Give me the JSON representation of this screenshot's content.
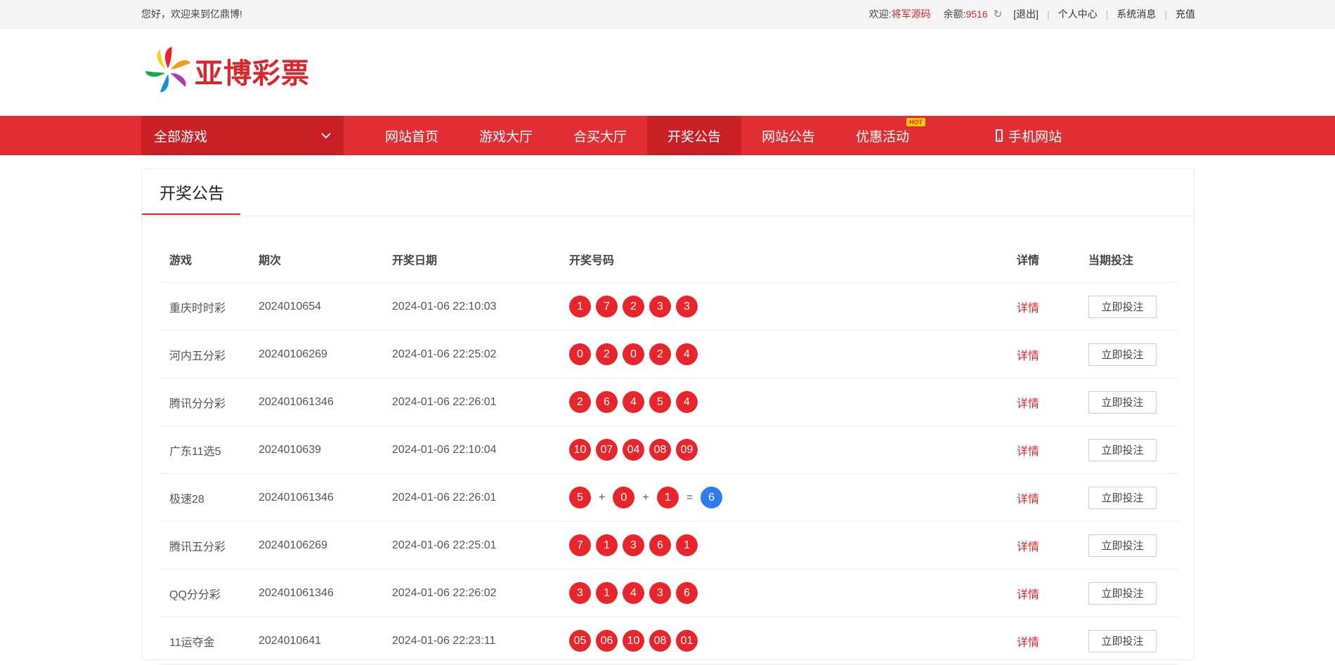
{
  "topbar": {
    "greeting": "您好，欢迎来到亿鼎博!",
    "welcome_label": "欢迎:",
    "username": "将军源码",
    "balance_label": "余额:",
    "balance": "9516",
    "logout": "[退出]",
    "personal_center": "个人中心",
    "messages": "系统消息",
    "recharge": "充值"
  },
  "logo": {
    "text": "亚博彩票"
  },
  "nav": {
    "all_games": "全部游戏",
    "items": [
      {
        "label": "网站首页",
        "active": false
      },
      {
        "label": "游戏大厅",
        "active": false
      },
      {
        "label": "合买大厅",
        "active": false
      },
      {
        "label": "开奖公告",
        "active": true
      },
      {
        "label": "网站公告",
        "active": false
      },
      {
        "label": "优惠活动",
        "active": false,
        "badge": "HOT"
      }
    ],
    "mobile": "手机网站"
  },
  "panel": {
    "title": "开奖公告"
  },
  "table": {
    "headers": [
      "游戏",
      "期次",
      "开奖日期",
      "开奖号码",
      "详情",
      "当期投注"
    ],
    "rows": [
      {
        "game": "重庆时时彩",
        "issue": "2024010654",
        "date": "2024-01-06 22:10:03",
        "numbers": [
          "1",
          "7",
          "2",
          "3",
          "3"
        ],
        "detail": "详情",
        "bet": "立即投注"
      },
      {
        "game": "河内五分彩",
        "issue": "20240106269",
        "date": "2024-01-06 22:25:02",
        "numbers": [
          "0",
          "2",
          "0",
          "2",
          "4"
        ],
        "detail": "详情",
        "bet": "立即投注"
      },
      {
        "game": "腾讯分分彩",
        "issue": "202401061346",
        "date": "2024-01-06 22:26:01",
        "numbers": [
          "2",
          "6",
          "4",
          "5",
          "4"
        ],
        "detail": "详情",
        "bet": "立即投注"
      },
      {
        "game": "广东11选5",
        "issue": "2024010639",
        "date": "2024-01-06 22:10:04",
        "numbers": [
          "10",
          "07",
          "04",
          "08",
          "09"
        ],
        "detail": "详情",
        "bet": "立即投注"
      },
      {
        "game": "极速28",
        "issue": "202401061346",
        "date": "2024-01-06 22:26:01",
        "numbers": [
          "5",
          "0",
          "1"
        ],
        "operators": [
          "+",
          "+",
          "="
        ],
        "result": "6",
        "detail": "详情",
        "bet": "立即投注"
      },
      {
        "game": "腾讯五分彩",
        "issue": "20240106269",
        "date": "2024-01-06 22:25:01",
        "numbers": [
          "7",
          "1",
          "3",
          "6",
          "1"
        ],
        "detail": "详情",
        "bet": "立即投注"
      },
      {
        "game": "QQ分分彩",
        "issue": "202401061346",
        "date": "2024-01-06 22:26:02",
        "numbers": [
          "3",
          "1",
          "4",
          "3",
          "6"
        ],
        "detail": "详情",
        "bet": "立即投注"
      },
      {
        "game": "11运夺金",
        "issue": "2024010641",
        "date": "2024-01-06 22:23:11",
        "numbers": [
          "05",
          "06",
          "10",
          "08",
          "01"
        ],
        "detail": "详情",
        "bet": "立即投注"
      }
    ]
  },
  "colors": {
    "brand_red": "#e02e32",
    "ball_red": "#e8252b",
    "ball_blue": "#2e7dee"
  }
}
